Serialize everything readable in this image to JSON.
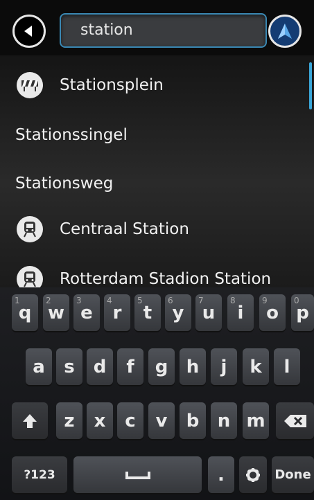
{
  "search": {
    "value": "station"
  },
  "results": [
    {
      "label": "Stationsplein",
      "icon": "roadwork-barrier-icon"
    },
    {
      "label": "Stationssingel",
      "icon": ""
    },
    {
      "label": "Stationsweg",
      "icon": ""
    },
    {
      "label": "Centraal Station",
      "icon": "train-icon"
    },
    {
      "label": "Rotterdam Stadion Station",
      "icon": "train-icon"
    }
  ],
  "keyboard": {
    "row1": [
      "q",
      "w",
      "e",
      "r",
      "t",
      "y",
      "u",
      "i",
      "o",
      "p"
    ],
    "row1_numbers": [
      "1",
      "2",
      "3",
      "4",
      "5",
      "6",
      "7",
      "8",
      "9",
      "0"
    ],
    "row2": [
      "a",
      "s",
      "d",
      "f",
      "g",
      "h",
      "j",
      "k",
      "l"
    ],
    "row3": [
      "z",
      "x",
      "c",
      "v",
      "b",
      "n",
      "m"
    ],
    "symbols_label": "?123",
    "period_label": ".",
    "done_label": "Done"
  },
  "colors": {
    "accent": "#3ba7d9",
    "nav_button": "#143c73"
  }
}
